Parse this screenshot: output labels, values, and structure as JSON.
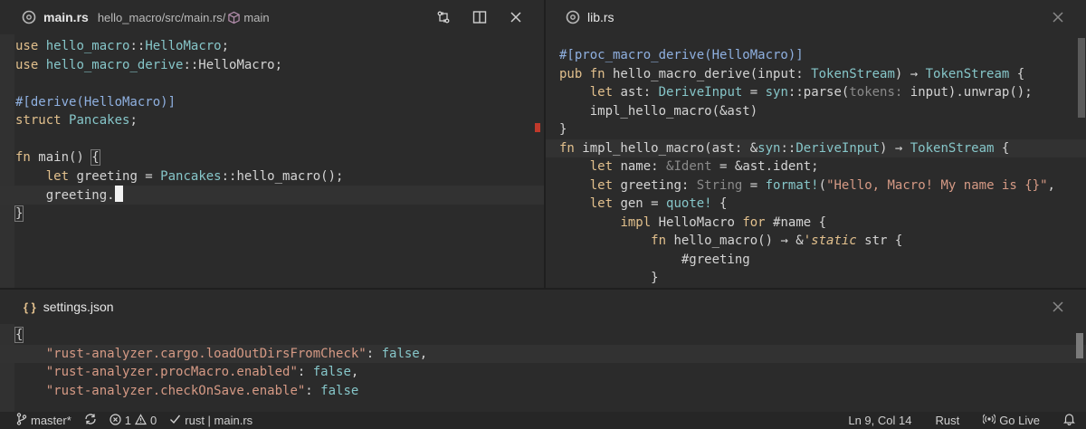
{
  "panes": {
    "main": {
      "tab_title": "main.rs",
      "breadcrumb_path": "hello_macro/src/main.rs/",
      "breadcrumb_symbol": "main",
      "icons": [
        "rust-file-icon",
        "cube-icon",
        "compare-changes-icon",
        "split-editor-icon",
        "close-icon"
      ],
      "lines": [
        "use hello_macro::HelloMacro;",
        "use hello_macro_derive::HelloMacro;",
        "",
        "#[derive(HelloMacro)]",
        "struct Pancakes;",
        "",
        "fn main() {",
        "    let greeting = Pancakes::hello_macro();",
        "    greeting.",
        "}"
      ]
    },
    "lib": {
      "tab_title": "lib.rs",
      "icons": [
        "rust-file-icon",
        "close-icon"
      ],
      "lines": [
        "#[proc_macro_derive(HelloMacro)]",
        "pub fn hello_macro_derive(input: TokenStream) → TokenStream {",
        "    let ast: DeriveInput = syn::parse(tokens: input).unwrap();",
        "    impl_hello_macro(&ast)",
        "}",
        "fn impl_hello_macro(ast: &syn::DeriveInput) → TokenStream {",
        "    let name: &Ident = &ast.ident;",
        "    let greeting: String = format!(\"Hello, Macro! My name is {}\",",
        "    let gen = quote! {",
        "        impl HelloMacro for #name {",
        "            fn hello_macro() → &'static str {",
        "                #greeting",
        "            }"
      ]
    },
    "settings": {
      "tab_title": "settings.json",
      "tab_icon_text": "{ }",
      "icons": [
        "json-braces-icon",
        "close-icon"
      ],
      "lines": [
        "{",
        "    \"rust-analyzer.cargo.loadOutDirsFromCheck\": false,",
        "    \"rust-analyzer.procMacro.enabled\": false,",
        "    \"rust-analyzer.checkOnSave.enable\": false"
      ]
    }
  },
  "statusbar": {
    "branch": "master*",
    "errors": "1",
    "warnings": "0",
    "context": "rust | main.rs",
    "position": "Ln 9, Col 14",
    "language": "Rust",
    "go_live": "Go Live"
  },
  "colors": {
    "background": "#2b2b2b",
    "keyword": "#e2c08d",
    "type": "#86c6c9",
    "string": "#d69a85",
    "attribute": "#8fb0e0",
    "error_marker": "#c0392b"
  }
}
